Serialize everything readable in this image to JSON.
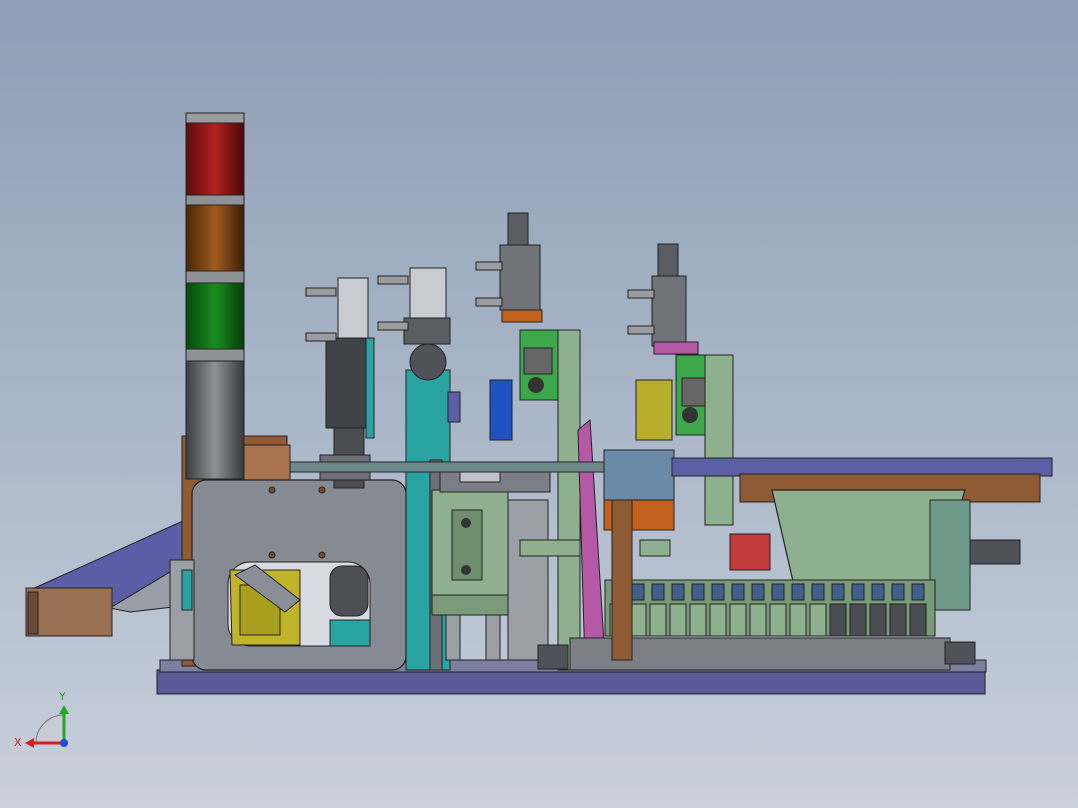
{
  "viewport": {
    "background_top": "#8e9eb4",
    "background_bottom": "#c9d0db"
  },
  "triad": {
    "x_label": "X",
    "y_label": "Y",
    "x_color": "#d42020",
    "y_color": "#1fa82a",
    "z_color": "#1d4fd8"
  },
  "model": {
    "palette": {
      "base_plate": "#5a5a96",
      "frame_gray": "#868a92",
      "teal": "#2aa3a3",
      "sage": "#8fb08f",
      "dark_gray": "#3f4247",
      "brown": "#8f5b34",
      "purple_rail": "#5c5ea6",
      "magenta": "#b558a6",
      "olive": "#b7ae2c",
      "red": "#c23a3a"
    },
    "stack_light_colors": [
      "#a01818",
      "#8b4a14",
      "#127a16",
      "#6c6f74"
    ]
  }
}
